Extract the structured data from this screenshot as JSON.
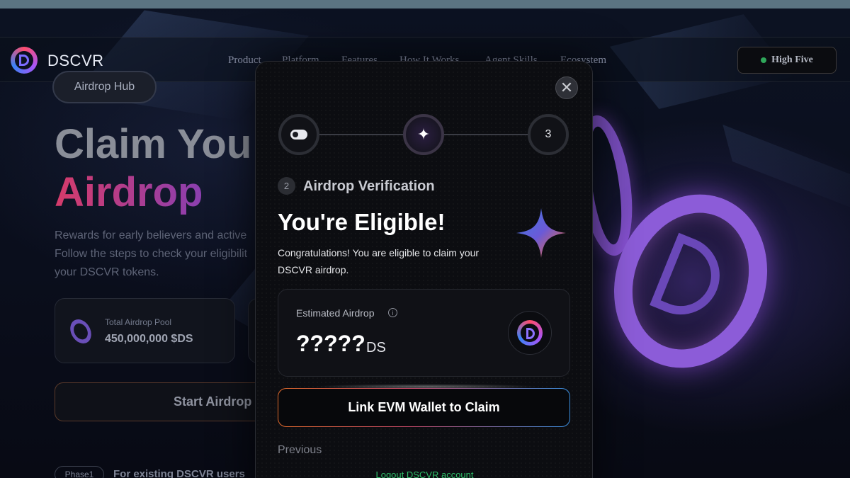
{
  "nav": {
    "brand": "DSCVR",
    "links": [
      "Product",
      "Platform",
      "Features",
      "How It Works",
      "Agent Skills",
      "Ecosystem"
    ],
    "cta_label": "High Five",
    "cta_status_color": "#2fa75a"
  },
  "hero": {
    "pill_label": "Airdrop Hub",
    "title_line1": "Claim You",
    "title_line2": "Airdrop",
    "desc_lines": [
      "Rewards for early believers and active",
      "Follow the steps to check your eligibilit",
      "your DSCVR tokens."
    ],
    "pool_label": "Total Airdrop Pool",
    "pool_value": "450,000,000 $DS",
    "start_button": "Start Airdrop",
    "phase_pill": "Phase1",
    "phase_text": "For existing DSCVR users"
  },
  "modal": {
    "close_icon": "close-icon",
    "steps": [
      {
        "icon": "toggle-icon",
        "state": "completed"
      },
      {
        "icon": "sparkle-icon",
        "state": "active"
      },
      {
        "label": "3",
        "state": "upcoming"
      }
    ],
    "step_number": "2",
    "step_title": "Airdrop Verification",
    "heading": "You're Eligible!",
    "message": "Congratulations! You are eligible to claim your DSCVR airdrop.",
    "estimate": {
      "label": "Estimated Airdrop",
      "value": "?????",
      "unit": "DS"
    },
    "primary_button": "Link EVM Wallet to Claim",
    "previous_button": "Previous",
    "logout_link": "Logout DSCVR account"
  },
  "colors": {
    "accent_gradient_start": "#e06a2c",
    "accent_gradient_end": "#3a8fe0",
    "logout_link": "#2fbf6a",
    "hero_gradient_start": "#d63b6a",
    "hero_gradient_end": "#8a3fb0"
  }
}
